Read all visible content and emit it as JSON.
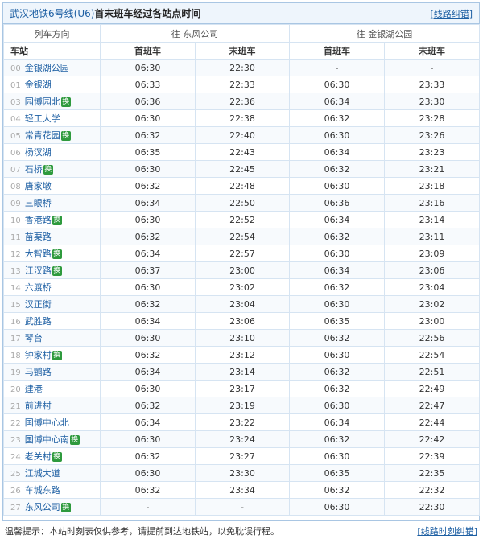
{
  "header": {
    "line_name": "武汉地铁6号线(U6)",
    "title_rest": "首末班车经过各站点时间",
    "correction_link": "[线路纠错]"
  },
  "directions": {
    "col_label": "列车方向",
    "dir1": "往 东风公司",
    "dir2": "往 金银湖公园"
  },
  "columns": {
    "station": "车站",
    "first": "首班车",
    "last": "末班车"
  },
  "transfer_badge": "换",
  "stations": [
    {
      "num": "00",
      "name": "金银湖公园",
      "transfer": false,
      "d1_first": "06:30",
      "d1_last": "22:30",
      "d2_first": "-",
      "d2_last": "-"
    },
    {
      "num": "01",
      "name": "金银湖",
      "transfer": false,
      "d1_first": "06:33",
      "d1_last": "22:33",
      "d2_first": "06:30",
      "d2_last": "23:33"
    },
    {
      "num": "03",
      "name": "园博园北",
      "transfer": true,
      "d1_first": "06:36",
      "d1_last": "22:36",
      "d2_first": "06:34",
      "d2_last": "23:30"
    },
    {
      "num": "04",
      "name": "轻工大学",
      "transfer": false,
      "d1_first": "06:30",
      "d1_last": "22:38",
      "d2_first": "06:32",
      "d2_last": "23:28"
    },
    {
      "num": "05",
      "name": "常青花园",
      "transfer": true,
      "d1_first": "06:32",
      "d1_last": "22:40",
      "d2_first": "06:30",
      "d2_last": "23:26"
    },
    {
      "num": "06",
      "name": "杨汊湖",
      "transfer": false,
      "d1_first": "06:35",
      "d1_last": "22:43",
      "d2_first": "06:34",
      "d2_last": "23:23"
    },
    {
      "num": "07",
      "name": "石桥",
      "transfer": true,
      "d1_first": "06:30",
      "d1_last": "22:45",
      "d2_first": "06:32",
      "d2_last": "23:21"
    },
    {
      "num": "08",
      "name": "唐家墩",
      "transfer": false,
      "d1_first": "06:32",
      "d1_last": "22:48",
      "d2_first": "06:30",
      "d2_last": "23:18"
    },
    {
      "num": "09",
      "name": "三眼桥",
      "transfer": false,
      "d1_first": "06:34",
      "d1_last": "22:50",
      "d2_first": "06:36",
      "d2_last": "23:16"
    },
    {
      "num": "10",
      "name": "香港路",
      "transfer": true,
      "d1_first": "06:30",
      "d1_last": "22:52",
      "d2_first": "06:34",
      "d2_last": "23:14"
    },
    {
      "num": "11",
      "name": "苗栗路",
      "transfer": false,
      "d1_first": "06:32",
      "d1_last": "22:54",
      "d2_first": "06:32",
      "d2_last": "23:11"
    },
    {
      "num": "12",
      "name": "大智路",
      "transfer": true,
      "d1_first": "06:34",
      "d1_last": "22:57",
      "d2_first": "06:30",
      "d2_last": "23:09"
    },
    {
      "num": "13",
      "name": "江汉路",
      "transfer": true,
      "d1_first": "06:37",
      "d1_last": "23:00",
      "d2_first": "06:34",
      "d2_last": "23:06"
    },
    {
      "num": "14",
      "name": "六渡桥",
      "transfer": false,
      "d1_first": "06:30",
      "d1_last": "23:02",
      "d2_first": "06:32",
      "d2_last": "23:04"
    },
    {
      "num": "15",
      "name": "汉正街",
      "transfer": false,
      "d1_first": "06:32",
      "d1_last": "23:04",
      "d2_first": "06:30",
      "d2_last": "23:02"
    },
    {
      "num": "16",
      "name": "武胜路",
      "transfer": false,
      "d1_first": "06:34",
      "d1_last": "23:06",
      "d2_first": "06:35",
      "d2_last": "23:00"
    },
    {
      "num": "17",
      "name": "琴台",
      "transfer": false,
      "d1_first": "06:30",
      "d1_last": "23:10",
      "d2_first": "06:32",
      "d2_last": "22:56"
    },
    {
      "num": "18",
      "name": "钟家村",
      "transfer": true,
      "d1_first": "06:32",
      "d1_last": "23:12",
      "d2_first": "06:30",
      "d2_last": "22:54"
    },
    {
      "num": "19",
      "name": "马鹦路",
      "transfer": false,
      "d1_first": "06:34",
      "d1_last": "23:14",
      "d2_first": "06:32",
      "d2_last": "22:51"
    },
    {
      "num": "20",
      "name": "建港",
      "transfer": false,
      "d1_first": "06:30",
      "d1_last": "23:17",
      "d2_first": "06:32",
      "d2_last": "22:49"
    },
    {
      "num": "21",
      "name": "前进村",
      "transfer": false,
      "d1_first": "06:32",
      "d1_last": "23:19",
      "d2_first": "06:30",
      "d2_last": "22:47"
    },
    {
      "num": "22",
      "name": "国博中心北",
      "transfer": false,
      "d1_first": "06:34",
      "d1_last": "23:22",
      "d2_first": "06:34",
      "d2_last": "22:44"
    },
    {
      "num": "23",
      "name": "国博中心南",
      "transfer": true,
      "d1_first": "06:30",
      "d1_last": "23:24",
      "d2_first": "06:32",
      "d2_last": "22:42"
    },
    {
      "num": "24",
      "name": "老关村",
      "transfer": true,
      "d1_first": "06:32",
      "d1_last": "23:27",
      "d2_first": "06:30",
      "d2_last": "22:39"
    },
    {
      "num": "25",
      "name": "江城大道",
      "transfer": false,
      "d1_first": "06:30",
      "d1_last": "23:30",
      "d2_first": "06:35",
      "d2_last": "22:35"
    },
    {
      "num": "26",
      "name": "车城东路",
      "transfer": false,
      "d1_first": "06:32",
      "d1_last": "23:34",
      "d2_first": "06:32",
      "d2_last": "22:32"
    },
    {
      "num": "27",
      "name": "东风公司",
      "transfer": true,
      "d1_first": "-",
      "d1_last": "-",
      "d2_first": "06:30",
      "d2_last": "22:30"
    }
  ],
  "footer": {
    "tip": "温馨提示：本站时刻表仅供参考，请提前到达地铁站，以免耽误行程。",
    "report_link": "[线路时刻纠错]"
  }
}
